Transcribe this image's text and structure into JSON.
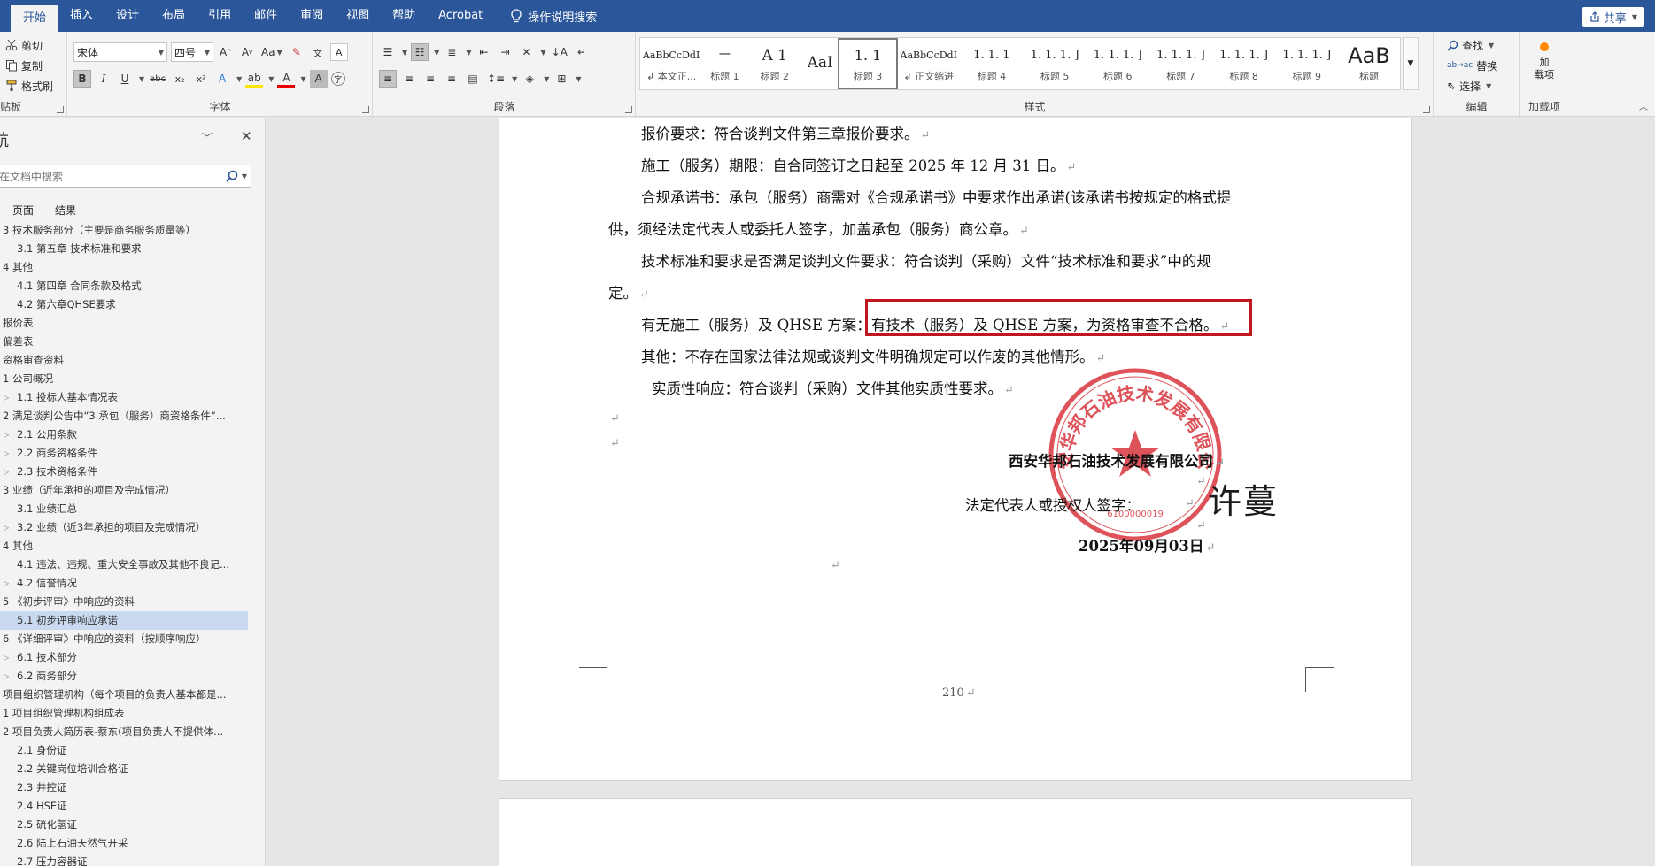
{
  "tabs": [
    "开始",
    "插入",
    "设计",
    "布局",
    "引用",
    "邮件",
    "审阅",
    "视图",
    "帮助",
    "Acrobat"
  ],
  "tell_me": "操作说明搜索",
  "share_label": "共享",
  "clipboard": {
    "cut": "剪切",
    "copy": "复制",
    "painter": "格式刷",
    "group": "贴板"
  },
  "font": {
    "name": "宋体",
    "size": "四号",
    "group": "字体",
    "aa": "Aa"
  },
  "paragraph": {
    "group": "段落"
  },
  "styles": {
    "group": "样式",
    "items": [
      {
        "sample": "AaBbCcDdI",
        "name": "↲ 本文正..."
      },
      {
        "sample": "一",
        "name": "标题 1"
      },
      {
        "sample": "A 1",
        "name": "标题 2"
      },
      {
        "sample": "AaI",
        "name": ""
      },
      {
        "sample": "1. 1",
        "name": "标题 3"
      },
      {
        "sample": "AaBbCcDdI",
        "name": "↲ 正文缩进"
      },
      {
        "sample": "1. 1. 1",
        "name": "标题 4"
      },
      {
        "sample": "1. 1. 1. ]",
        "name": "标题 5"
      },
      {
        "sample": "1. 1. 1. ]",
        "name": "标题 6"
      },
      {
        "sample": "1. 1. 1. ]",
        "name": "标题 7"
      },
      {
        "sample": "1. 1. 1. ]",
        "name": "标题 8"
      },
      {
        "sample": "1. 1. 1. ]",
        "name": "标题 9"
      },
      {
        "sample": "AaB",
        "name": "标题"
      }
    ]
  },
  "editing": {
    "find": "查找",
    "replace": "替换",
    "select": "选择",
    "group": "编辑"
  },
  "addins": {
    "label": "加载项",
    "btn": "加\n载项"
  },
  "nav": {
    "title": "导航",
    "search_placeholder": "在文档中搜索",
    "tab_pages": "页面",
    "tab_results": "结果",
    "items": [
      {
        "text": "3 技术服务部分（主要是商务服务质量等）",
        "level": 1,
        "caret": false
      },
      {
        "text": "3.1 第五章 技术标准和要求",
        "level": 2,
        "caret": false
      },
      {
        "text": "4 其他",
        "level": 1,
        "caret": false
      },
      {
        "text": "4.1 第四章 合同条款及格式",
        "level": 2,
        "caret": false
      },
      {
        "text": "4.2 第六章QHSE要求",
        "level": 2,
        "caret": false
      },
      {
        "text": "报价表",
        "level": 1,
        "caret": false
      },
      {
        "text": "偏差表",
        "level": 1,
        "caret": false
      },
      {
        "text": "资格审查资料",
        "level": 1,
        "caret": false
      },
      {
        "text": "1 公司概况",
        "level": 1,
        "caret": false
      },
      {
        "text": "1.1 投标人基本情况表",
        "level": 2,
        "caret": true
      },
      {
        "text": "2 满足谈判公告中“3.承包（服务）商资格条件”...",
        "level": 1,
        "caret": false
      },
      {
        "text": "2.1 公用条款",
        "level": 2,
        "caret": true
      },
      {
        "text": "2.2 商务资格条件",
        "level": 2,
        "caret": true
      },
      {
        "text": "2.3 技术资格条件",
        "level": 2,
        "caret": true
      },
      {
        "text": "3 业绩（近年承担的项目及完成情况）",
        "level": 1,
        "caret": false
      },
      {
        "text": "3.1 业绩汇总",
        "level": 2,
        "caret": false
      },
      {
        "text": "3.2 业绩（近3年承担的项目及完成情况）",
        "level": 2,
        "caret": true
      },
      {
        "text": "4 其他",
        "level": 1,
        "caret": false
      },
      {
        "text": "4.1 违法、违规、重大安全事故及其他不良记...",
        "level": 2,
        "caret": false
      },
      {
        "text": "4.2 信誉情况",
        "level": 2,
        "caret": true
      },
      {
        "text": "5 《初步评审》中响应的资料",
        "level": 1,
        "caret": false
      },
      {
        "text": "5.1 初步评审响应承诺",
        "level": 2,
        "caret": false,
        "selected": true
      },
      {
        "text": "6 《详细评审》中响应的资料（按顺序响应）",
        "level": 1,
        "caret": false
      },
      {
        "text": "6.1 技术部分",
        "level": 2,
        "caret": true
      },
      {
        "text": "6.2 商务部分",
        "level": 2,
        "caret": true
      },
      {
        "text": "项目组织管理机构（每个项目的负责人基本都是...",
        "level": 1,
        "caret": false
      },
      {
        "text": "1 项目组织管理机构组成表",
        "level": 1,
        "caret": false
      },
      {
        "text": "2 项目负责人简历表-蔡东(项目负责人不提供体...",
        "level": 1,
        "caret": false
      },
      {
        "text": "2.1 身份证",
        "level": 2,
        "caret": false
      },
      {
        "text": "2.2 关键岗位培训合格证",
        "level": 2,
        "caret": false
      },
      {
        "text": "2.3 井控证",
        "level": 2,
        "caret": false
      },
      {
        "text": "2.4 HSE证",
        "level": 2,
        "caret": false
      },
      {
        "text": "2.5 硫化氢证",
        "level": 2,
        "caret": false
      },
      {
        "text": "2.6 陆上石油天然气开采",
        "level": 2,
        "caret": false
      },
      {
        "text": "2.7 压力容器证",
        "level": 2,
        "caret": false
      }
    ]
  },
  "doc": {
    "l1": "报价要求：符合谈判文件第三章报价要求。",
    "l2": "施工（服务）期限：自合同签订之日起至 2025 年 12 月 31 日。",
    "l3": "合规承诺书：承包（服务）商需对《合规承诺书》中要求作出承诺(该承诺书按规定的格式提",
    "l4": "供，须经法定代表人或委托人签字，加盖承包（服务）商公章。",
    "l5": "技术标准和要求是否满足谈判文件要求：符合谈判（采购）文件“技术标准和要求”中的规",
    "l6": "定。",
    "l7a": "有无施工（服务）及 QHSE 方案：",
    "l7b": "有技术（服务）及 QHSE 方案，为资格审查不合格。",
    "l8": "其他：不存在国家法律法规或谈判文件明确规定可以作废的其他情形。",
    "l9": "实质性响应：符合谈判（采购）文件其他实质性要求。",
    "company": "西安华邦石油技术发展有限公司",
    "rep_label": "法定代表人或授权人签字：",
    "signature": "许蔓",
    "date": "2025年09月03日",
    "page_no": "210",
    "seal_text": "西安华邦石油技术发展有限公司",
    "seal_code": "6100000019"
  },
  "colors": {
    "accent": "#2b579a",
    "highlight_box": "#c0171e",
    "seal": "#d9363e"
  }
}
